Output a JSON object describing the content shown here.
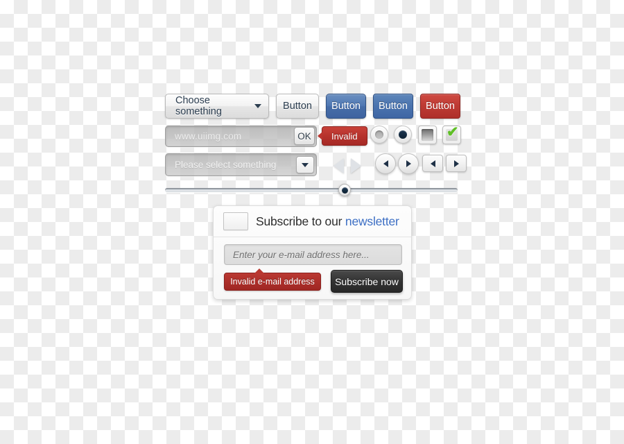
{
  "row_buttons": {
    "dropdown": {
      "label": "Choose something",
      "caret_icon": "chevron-down-icon"
    },
    "plain_button": "Button",
    "blue_button_a": "Button",
    "blue_button_b": "Button",
    "red_button": "Button"
  },
  "row_input": {
    "text_value": "www.uiimg.com",
    "ok_label": "OK",
    "invalid_tooltip": "Invalid",
    "radio_unselected": "radio-unselected",
    "radio_selected": "radio-selected",
    "checkbox_unchecked": "checkbox-unchecked",
    "checkbox_checked": "checkbox-checked",
    "check_glyph": "✔"
  },
  "row_select": {
    "placeholder": "Please select something",
    "caret_icon": "chevron-down-icon",
    "arrows": {
      "flat_prev": "triangle-left-icon",
      "flat_next": "triangle-right-icon",
      "circle_prev": "circle-arrow-left-icon",
      "circle_next": "circle-arrow-right-icon",
      "rect_prev": "rect-arrow-left-icon",
      "rect_next": "rect-arrow-right-icon"
    }
  },
  "slider": {
    "value_percent": 62,
    "handle_name": "slider-handle"
  },
  "subscribe_panel": {
    "icon": "envelope-icon",
    "title_main": "Subscribe to our ",
    "title_accent": "newsletter",
    "email_placeholder": "Enter your e-mail address here...",
    "email_value": "",
    "invalid_message": "Invalid e-mail address",
    "submit_label": "Subscribe now"
  },
  "colors": {
    "blue": "#4a73ae",
    "red": "#b6322c",
    "dark": "#333333",
    "accent_link": "#3d6fc4",
    "check_green": "#5fbf26",
    "checker_light": "#ffffff",
    "checker_dark": "#ececec"
  }
}
